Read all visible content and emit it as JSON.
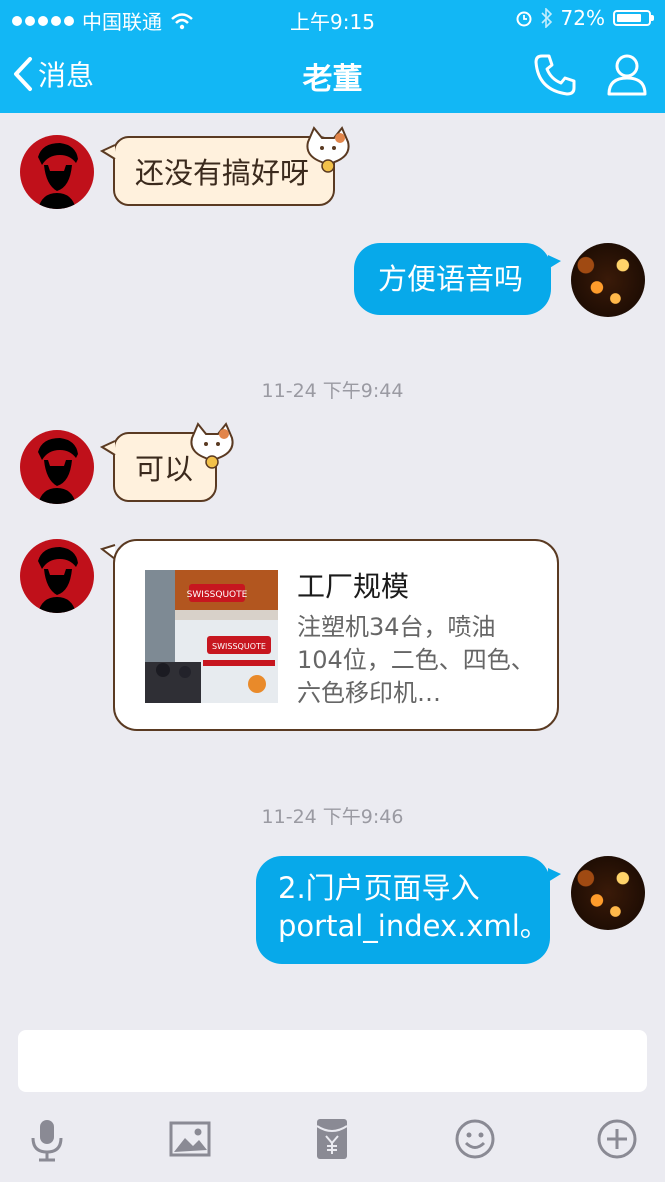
{
  "status_bar": {
    "carrier": "中国联通",
    "time": "上午9:15",
    "battery": "72%",
    "battery_level": 0.72
  },
  "nav": {
    "back_label": "消息",
    "title": "老董",
    "icons": [
      "phone-icon",
      "profile-icon"
    ]
  },
  "messages": [
    {
      "side": "left",
      "text": "还没有搞好呀",
      "avatar": "che-avatar"
    },
    {
      "side": "right",
      "text": "方便语音吗",
      "avatar": "bokeh-avatar"
    },
    {
      "type": "timestamp",
      "text": "11-24 下午9:44"
    },
    {
      "side": "left",
      "text": "可以",
      "avatar": "che-avatar"
    },
    {
      "side": "left",
      "type": "link-card",
      "card": {
        "title": "工厂规模",
        "description": "注塑机34台，喷油104位，二色、四色、六色移印机…",
        "thumb_brand": "SWISSQUOTE"
      }
    },
    {
      "type": "timestamp",
      "text": "11-24 下午9:46"
    },
    {
      "side": "right",
      "text": "2.门户页面导入portal_index.xml。",
      "lines": [
        "2.门户页面导入",
        "portal_index.xml。"
      ]
    }
  ],
  "input": {
    "value": "",
    "placeholder": ""
  },
  "toolbar": [
    "microphone-icon",
    "image-icon",
    "red-envelope-icon",
    "emoji-icon",
    "plus-icon"
  ],
  "colors": {
    "header": "#12b7f5",
    "bubble_blue": "#07a9ea",
    "background": "#ebebf1"
  }
}
